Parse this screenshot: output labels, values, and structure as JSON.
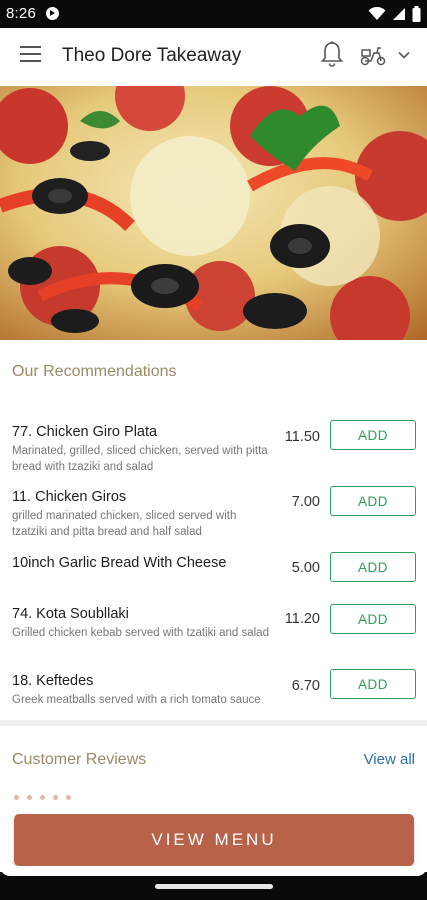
{
  "status_bar": {
    "time": "8:26"
  },
  "app_bar": {
    "title": "Theo Dore Takeaway"
  },
  "recommendations": {
    "title": "Our Recommendations",
    "items": [
      {
        "name": "77. Chicken Giro Plata",
        "description": "Marinated, grilled, sliced chicken, served with pitta bread with tzaziki and salad",
        "price": "11.50",
        "button": "ADD"
      },
      {
        "name": "11. Chicken Giros",
        "description": "grilled marinated chicken, sliced served with tzatziki and pitta bread and half salad",
        "price": "7.00",
        "button": "ADD"
      },
      {
        "name": "10inch Garlic Bread With Cheese",
        "description": "",
        "price": "5.00",
        "button": "ADD"
      },
      {
        "name": "74. Kota Soubllaki",
        "description": "Grilled chicken kebab served with tzatiki and salad",
        "price": "11.20",
        "button": "ADD"
      },
      {
        "name": "18. Keftedes",
        "description": "Greek meatballs served with a rich tomato sauce",
        "price": "6.70",
        "button": "ADD"
      }
    ]
  },
  "reviews": {
    "title": "Customer Reviews",
    "view_all": "View all"
  },
  "cta": {
    "label": "VIEW MENU"
  },
  "colors": {
    "accent": "#b8624a",
    "add_green": "#2ea05a",
    "section_title": "#9a8a67",
    "link": "#2a6fa8"
  }
}
